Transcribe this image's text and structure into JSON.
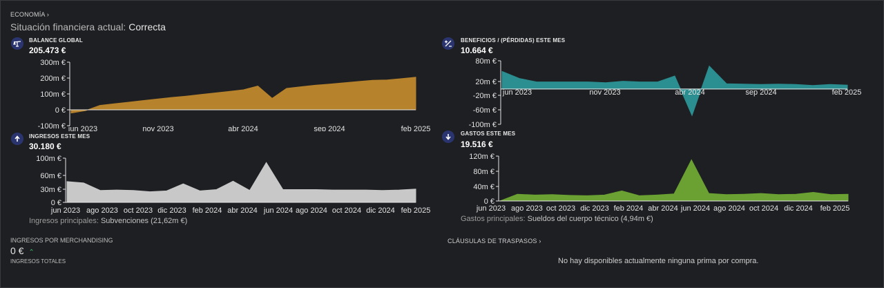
{
  "header": {
    "breadcrumb": "ECONOMÍA",
    "status_label": "Situación financiera actual:",
    "status_value": "Correcta"
  },
  "charts": [
    {
      "title": "BALANCE GLOBAL",
      "value": "205.473 €",
      "icon": "scale-icon",
      "color": "#b7822c",
      "note_label": "",
      "note_value": "",
      "y_ticks": [
        "300m €",
        "200m €",
        "100m €",
        "0 €",
        "-100m €"
      ],
      "x_ticks": [
        "jun 2023",
        "nov 2023",
        "abr 2024",
        "sep 2024",
        "feb 2025"
      ]
    },
    {
      "title": "BENEFICIOS / (PÉRDIDAS) ESTE MES",
      "value": "10.664 €",
      "icon": "plus-minus-icon",
      "color": "#2b8e90",
      "note_label": "",
      "note_value": "",
      "y_ticks": [
        "80m €",
        "20m €",
        "-20m €",
        "-60m €",
        "-100m €"
      ],
      "x_ticks": [
        "jun 2023",
        "nov 2023",
        "abr 2024",
        "sep 2024",
        "feb 2025"
      ]
    },
    {
      "title": "INGRESOS ESTE MES",
      "value": "30.180 €",
      "icon": "arrow-up-icon",
      "color": "#c8c8c8",
      "note_label": "Ingresos principales:",
      "note_value": "Subvenciones (21,62m €)",
      "y_ticks": [
        "100m €",
        "60m €",
        "30m €",
        "0 €"
      ],
      "x_ticks": [
        "jun 2023",
        "ago 2023",
        "oct 2023",
        "dic 2023",
        "feb 2024",
        "abr 2024",
        "jun 2024",
        "ago 2024",
        "oct 2024",
        "dic 2024",
        "feb 2025"
      ]
    },
    {
      "title": "GASTOS ESTE MES",
      "value": "19.516 €",
      "icon": "arrow-down-icon",
      "color": "#6aa132",
      "note_label": "Gastos principales:",
      "note_value": "Sueldos del cuerpo técnico (4,94m €)",
      "y_ticks": [
        "120m €",
        "80m €",
        "40m €",
        "0 €"
      ],
      "x_ticks": [
        "jun 2023",
        "ago 2023",
        "oct 2023",
        "dic 2023",
        "feb 2024",
        "abr 2024",
        "jun 2024",
        "ago 2024",
        "oct 2024",
        "dic 2024",
        "feb 2025"
      ]
    }
  ],
  "chart_data": [
    {
      "type": "area",
      "title": "BALANCE GLOBAL",
      "ylim": [
        -100,
        300
      ],
      "y_unit": "m €",
      "x_range": [
        "may 2023",
        "feb 2025"
      ],
      "values": [
        -20,
        -5,
        28,
        38,
        48,
        58,
        68,
        78,
        86,
        96,
        106,
        116,
        126,
        150,
        72,
        135,
        145,
        155,
        162,
        170,
        178,
        186,
        188,
        196,
        205
      ]
    },
    {
      "type": "area",
      "title": "BENEFICIOS / (PÉRDIDAS) ESTE MES",
      "ylim": [
        -100,
        80
      ],
      "y_unit": "m €",
      "x_range": [
        "may 2023",
        "feb 2025"
      ],
      "values": [
        50,
        30,
        20,
        20,
        20,
        20,
        18,
        22,
        20,
        20,
        37,
        -75,
        65,
        15,
        14,
        13,
        14,
        13,
        10,
        13,
        11
      ]
    },
    {
      "type": "area",
      "title": "INGRESOS ESTE MES",
      "ylim": [
        0,
        100
      ],
      "y_unit": "m €",
      "x_range": [
        "may 2023",
        "feb 2025"
      ],
      "values": [
        47,
        44,
        27,
        28,
        27,
        24,
        26,
        42,
        26,
        29,
        48,
        27,
        90,
        29,
        29,
        29,
        28,
        28,
        28,
        27,
        28,
        30
      ]
    },
    {
      "type": "area",
      "title": "GASTOS ESTE MES",
      "ylim": [
        0,
        120
      ],
      "y_unit": "m €",
      "x_range": [
        "jun 2023",
        "feb 2025"
      ],
      "values": [
        0,
        18,
        16,
        17,
        15,
        14,
        16,
        27,
        14,
        16,
        19,
        110,
        20,
        17,
        18,
        20,
        17,
        18,
        23,
        17,
        18
      ]
    }
  ],
  "merch": {
    "label": "INGRESOS POR MERCHANDISING",
    "value": "0 €",
    "sub": "INGRESOS TOTALES"
  },
  "transfers": {
    "label": "CLÁUSULAS DE TRASPASOS",
    "empty": "No hay disponibles actualmente ninguna prima por compra."
  }
}
